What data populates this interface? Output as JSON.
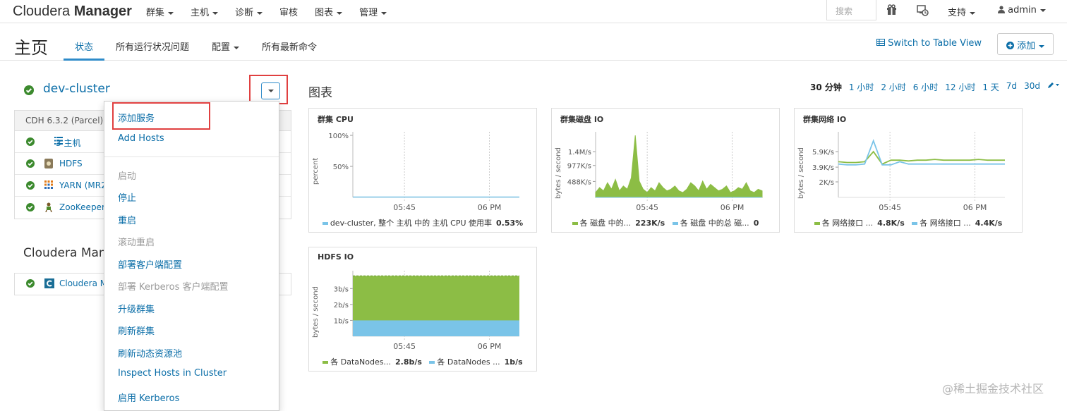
{
  "header": {
    "brand_light": "Cloudera ",
    "brand_bold": "Manager",
    "nav": [
      "群集",
      "主机",
      "诊断",
      "审核",
      "图表",
      "管理"
    ],
    "search_placeholder": "搜索",
    "support": "支持",
    "user": "admin"
  },
  "subnav": {
    "title": "主页",
    "tabs": [
      "状态",
      "所有运行状况问题",
      "配置",
      "所有最新命令"
    ],
    "switch_view": "Switch to Table View",
    "add_button": "添加"
  },
  "cluster": {
    "name": "dev-cluster",
    "version": "CDH 6.3.2 (Parcel)",
    "services": [
      {
        "name": "3 主机",
        "icon": "hosts-list-icon"
      },
      {
        "name": "HDFS",
        "icon": "hdfs-icon"
      },
      {
        "name": "YARN (MR2",
        "icon": "yarn-icon"
      },
      {
        "name": "ZooKeeper",
        "icon": "zookeeper-icon"
      }
    ]
  },
  "cloudera_manager": {
    "title": "Cloudera Mana",
    "row": "Cloudera M"
  },
  "dropdown": {
    "items": [
      {
        "label": "添加服务",
        "disabled": false
      },
      {
        "label": "Add Hosts",
        "disabled": false
      },
      {
        "label": "启动",
        "disabled": true
      },
      {
        "label": "停止",
        "disabled": false
      },
      {
        "label": "重启",
        "disabled": false
      },
      {
        "label": "滚动重启",
        "disabled": true
      },
      {
        "label": "部署客户端配置",
        "disabled": false
      },
      {
        "label": "部署 Kerberos 客户端配置",
        "disabled": true
      },
      {
        "label": "升级群集",
        "disabled": false
      },
      {
        "label": "刷新群集",
        "disabled": false
      },
      {
        "label": "刷新动态资源池",
        "disabled": false
      },
      {
        "label": "Inspect Hosts in Cluster",
        "disabled": false
      },
      {
        "label": "启用 Kerberos",
        "disabled": false
      }
    ]
  },
  "charts_section": {
    "title": "图表",
    "time_ranges": [
      "30 分钟",
      "1 小时",
      "2 小时",
      "6 小时",
      "12 小时",
      "1 天",
      "7d",
      "30d"
    ],
    "selected_range": "30 分钟"
  },
  "colors": {
    "accent": "#0b6ea8",
    "green": "#8cbd45",
    "blue": "#7ac4e8",
    "ok": "#3c8a2e",
    "highlight": "#e04040"
  },
  "chart_data": [
    {
      "type": "line",
      "title": "群集 CPU",
      "ylabel": "percent",
      "yticks": [
        "100%",
        "50%"
      ],
      "ylim": [
        0,
        100
      ],
      "xticks": [
        "05:45",
        "06 PM"
      ],
      "series": [
        {
          "name": "dev-cluster, 整个 主机 中的 主机 CPU 使用率",
          "color": "#7ac4e8",
          "values": [
            0.5,
            0.5,
            0.5,
            0.5,
            0.5,
            0.5,
            0.5,
            0.5,
            0.5,
            0.5
          ],
          "summary": "0.53%"
        }
      ]
    },
    {
      "type": "area",
      "title": "群集磁盘 IO",
      "ylabel": "bytes / second",
      "yticks": [
        "1.4M/s",
        "977K/s",
        "488K/s"
      ],
      "ylim": [
        0,
        1900000
      ],
      "xticks": [
        "05:45",
        "06 PM"
      ],
      "series": [
        {
          "name": "各 磁盘 中的...",
          "color": "#8cbd45",
          "summary": "223K/s",
          "values": [
            150,
            300,
            200,
            450,
            250,
            550,
            200,
            350,
            250,
            600,
            1900,
            500,
            250,
            150,
            300,
            200,
            450,
            300,
            200,
            250,
            350,
            200,
            150,
            250,
            450,
            350,
            200,
            500,
            250,
            400,
            300,
            200,
            250,
            350,
            150,
            200,
            300,
            250,
            450,
            200,
            150,
            250,
            200
          ]
        },
        {
          "name": "各 磁盘 中的总 磁...",
          "color": "#7ac4e8",
          "summary": "0",
          "values": [
            0,
            0,
            0,
            0,
            0,
            0,
            0,
            0,
            0,
            0
          ]
        }
      ]
    },
    {
      "type": "line",
      "title": "群集网络 IO",
      "ylabel": "bytes / second",
      "yticks": [
        "5.9K/s",
        "3.9K/s",
        "2K/s"
      ],
      "ylim": [
        0,
        8000
      ],
      "xticks": [
        "05:45",
        "06 PM"
      ],
      "series": [
        {
          "name": "各 网络接口 ...",
          "color": "#8cbd45",
          "summary": "4.8K/s",
          "values": [
            4.6,
            4.5,
            4.5,
            4.6,
            5.9,
            4.3,
            4.8,
            4.8,
            4.7,
            4.8,
            4.8,
            4.9,
            4.8,
            4.8,
            4.8,
            4.8,
            4.9,
            4.8,
            4.8,
            4.8
          ]
        },
        {
          "name": "各 网络接口 ...",
          "color": "#7ac4e8",
          "summary": "4.4K/s",
          "values": [
            4.3,
            4.2,
            4.2,
            4.3,
            7.3,
            4.2,
            4.2,
            4.6,
            4.3,
            4.3,
            4.3,
            4.3,
            4.3,
            4.3,
            4.3,
            4.3,
            4.3,
            4.3,
            4.3,
            4.3
          ]
        }
      ]
    },
    {
      "type": "area",
      "title": "HDFS IO",
      "ylabel": "bytes / second",
      "yticks": [
        "3b/s",
        "2b/s",
        "1b/s"
      ],
      "ylim": [
        0,
        3.6
      ],
      "xticks": [
        "05:45",
        "06 PM"
      ],
      "series": [
        {
          "name": "各 DataNodes...",
          "color": "#8cbd45",
          "summary": "2.8b/s",
          "values": [
            3.8,
            3.8
          ]
        },
        {
          "name": "各 DataNodes ...",
          "color": "#7ac4e8",
          "summary": "1b/s",
          "values": [
            1,
            1
          ]
        }
      ]
    }
  ],
  "watermark": "@稀土掘金技术社区"
}
